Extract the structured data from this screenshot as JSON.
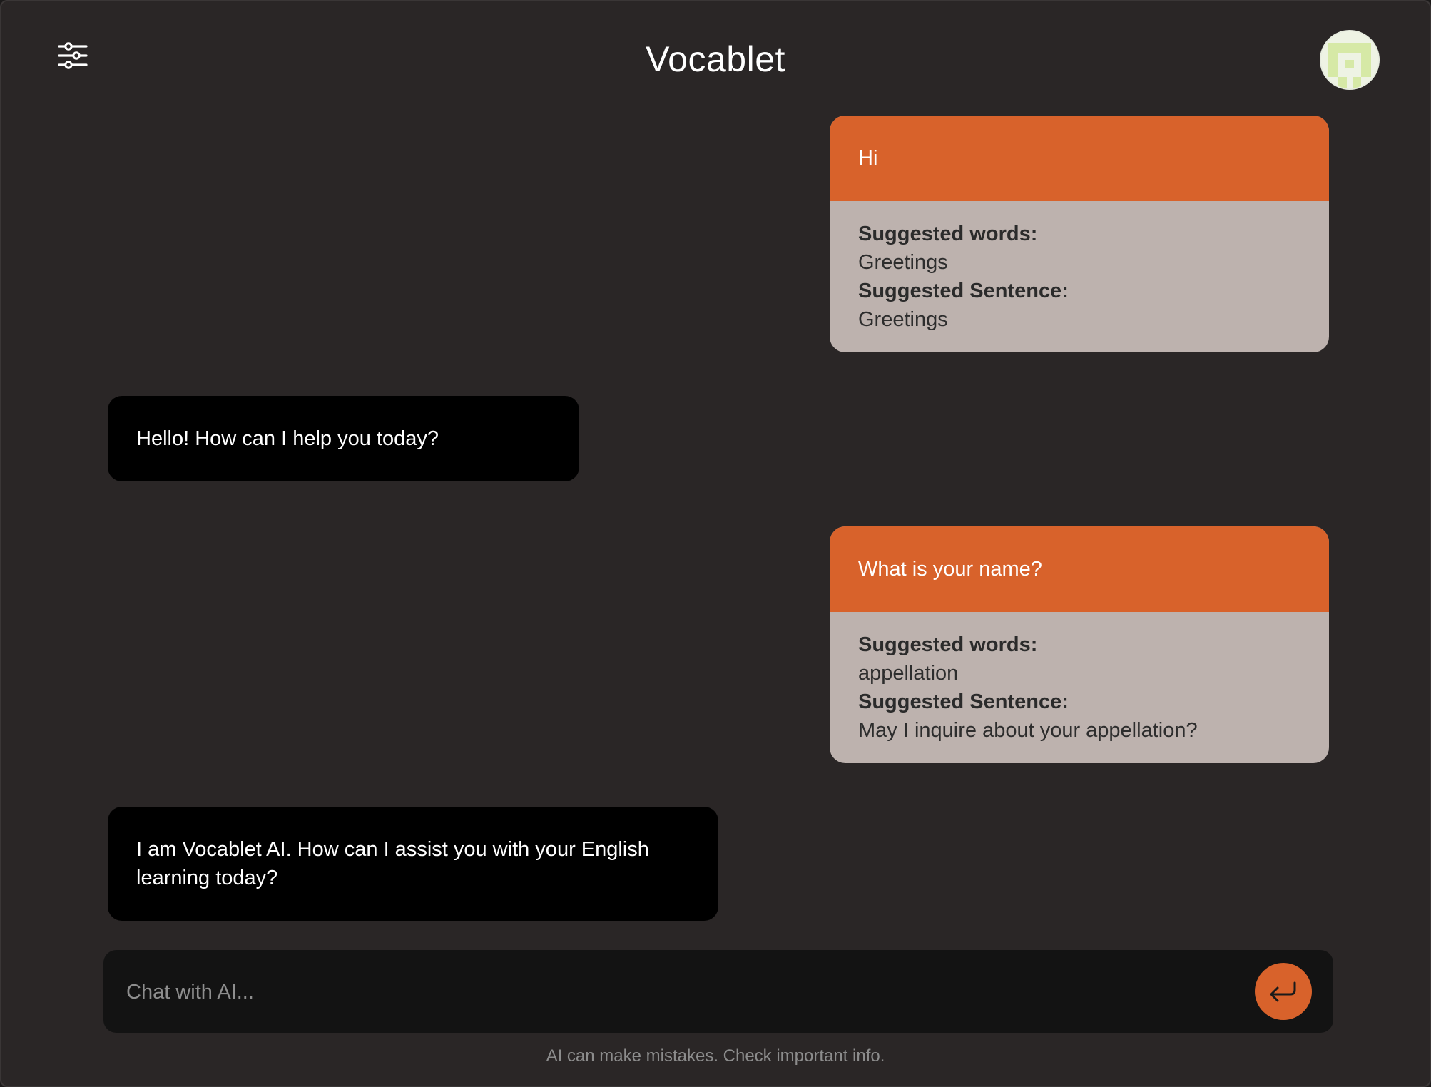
{
  "header": {
    "title": "Vocablet",
    "settings_icon": "sliders-icon",
    "avatar_icon": "user-avatar"
  },
  "labels": {
    "suggested_words": "Suggested words:",
    "suggested_sentence": "Suggested Sentence:"
  },
  "messages": [
    {
      "role": "user",
      "text": "Hi",
      "suggested_words": "Greetings",
      "suggested_sentence": "Greetings"
    },
    {
      "role": "ai",
      "text": "Hello! How can I help you today?"
    },
    {
      "role": "user",
      "text": "What is your name?",
      "suggested_words": "appellation",
      "suggested_sentence": "May I inquire about your appellation?"
    },
    {
      "role": "ai",
      "text": "I am Vocablet AI. How can I assist you with your English learning today?"
    }
  ],
  "input": {
    "placeholder": "Chat with AI...",
    "value": "",
    "send_icon": "enter-return-icon"
  },
  "footer": {
    "disclaimer": "AI can make mistakes. Check important info."
  },
  "colors": {
    "background": "#2a2626",
    "accent": "#d8622b",
    "suggestion_panel": "#bdb2ae",
    "ai_bubble": "#000000",
    "input_bar": "#131313"
  }
}
